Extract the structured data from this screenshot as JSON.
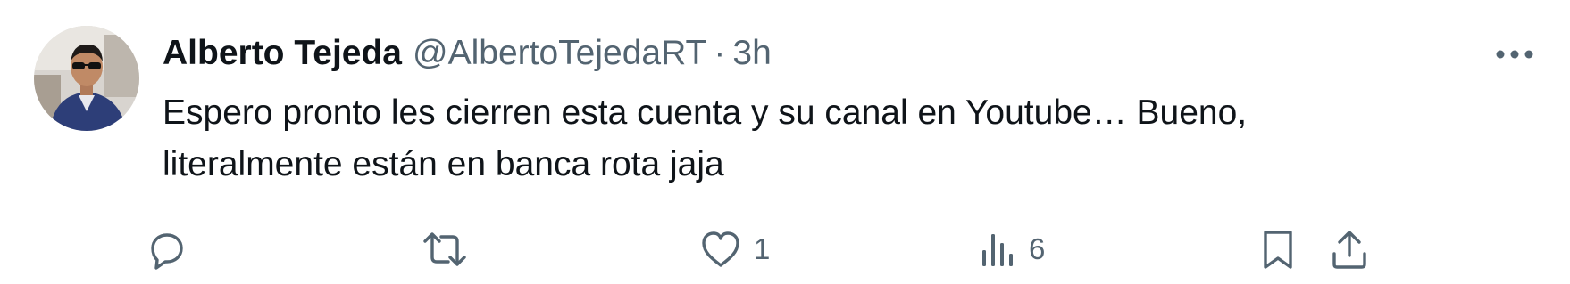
{
  "tweet": {
    "author": {
      "display_name": "Alberto Tejeda",
      "handle": "@AlbertoTejedaRT",
      "separator": "·",
      "timestamp": "3h"
    },
    "text_lines": [
      "Espero pronto les cierren esta cuenta y su canal en Youtube… Bueno,",
      "literalmente están en banca rota jaja"
    ],
    "actions": {
      "reply": {
        "icon": "reply-icon",
        "count": ""
      },
      "retweet": {
        "icon": "retweet-icon",
        "count": ""
      },
      "like": {
        "icon": "heart-icon",
        "count": "1"
      },
      "views": {
        "icon": "analytics-icon",
        "count": "6"
      },
      "bookmark": {
        "icon": "bookmark-icon"
      },
      "share": {
        "icon": "share-icon"
      }
    },
    "more_menu_icon": "more-dots-icon"
  },
  "colors": {
    "text_primary": "#0f1419",
    "text_secondary": "#536471",
    "background": "#ffffff"
  }
}
